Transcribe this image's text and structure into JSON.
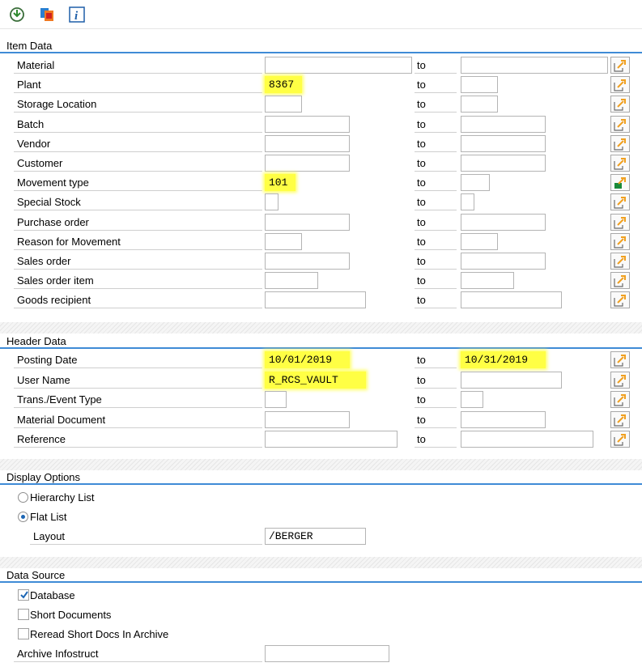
{
  "toolbar": {
    "icons": [
      "execute-icon",
      "selection-screen-icon",
      "info-icon"
    ],
    "info_glyph": "i"
  },
  "item_data": {
    "title": "Item Data",
    "to_label": "to",
    "rows": [
      {
        "label": "Material",
        "from": "",
        "to": "",
        "highlight_from": false
      },
      {
        "label": "Plant",
        "from": "8367",
        "to": "",
        "highlight_from": true
      },
      {
        "label": "Storage Location",
        "from": "",
        "to": ""
      },
      {
        "label": "Batch",
        "from": "",
        "to": ""
      },
      {
        "label": "Vendor",
        "from": "",
        "to": ""
      },
      {
        "label": "Customer",
        "from": "",
        "to": ""
      },
      {
        "label": "Movement type",
        "from": "101",
        "to": "",
        "highlight_from": true,
        "multi_active": true
      },
      {
        "label": "Special Stock",
        "from": "",
        "to": ""
      },
      {
        "label": "Purchase order",
        "from": "",
        "to": ""
      },
      {
        "label": "Reason for Movement",
        "from": "",
        "to": ""
      },
      {
        "label": "Sales order",
        "from": "",
        "to": ""
      },
      {
        "label": "Sales order item",
        "from": "",
        "to": ""
      },
      {
        "label": "Goods recipient",
        "from": "",
        "to": ""
      }
    ]
  },
  "header_data": {
    "title": "Header Data",
    "to_label": "to",
    "rows": [
      {
        "label": "Posting Date",
        "from": "10/01/2019",
        "to": "10/31/2019",
        "highlight_from": true,
        "highlight_to": true
      },
      {
        "label": "User Name",
        "from": "R_RCS_VAULT",
        "to": "",
        "highlight_from": true
      },
      {
        "label": "Trans./Event Type",
        "from": "",
        "to": ""
      },
      {
        "label": "Material Document",
        "from": "",
        "to": ""
      },
      {
        "label": "Reference",
        "from": "",
        "to": ""
      }
    ]
  },
  "display_options": {
    "title": "Display Options",
    "hierarchy_list": {
      "label": "Hierarchy List",
      "selected": false
    },
    "flat_list": {
      "label": "Flat List",
      "selected": true
    },
    "layout_label": "Layout",
    "layout_value": "/BERGER"
  },
  "data_source": {
    "title": "Data Source",
    "database": {
      "label": "Database",
      "checked": true
    },
    "short_documents": {
      "label": "Short Documents",
      "checked": false
    },
    "reread_short_docs": {
      "label": "Reread Short Docs In Archive",
      "checked": false
    },
    "archive_infostruct_label": "Archive Infostruct",
    "archive_infostruct_value": ""
  },
  "colors": {
    "section_line": "#3f8bd6",
    "highlight": "#ffff44",
    "multi_arrow": "#f0a020",
    "multi_active": "#1a8a3a"
  }
}
